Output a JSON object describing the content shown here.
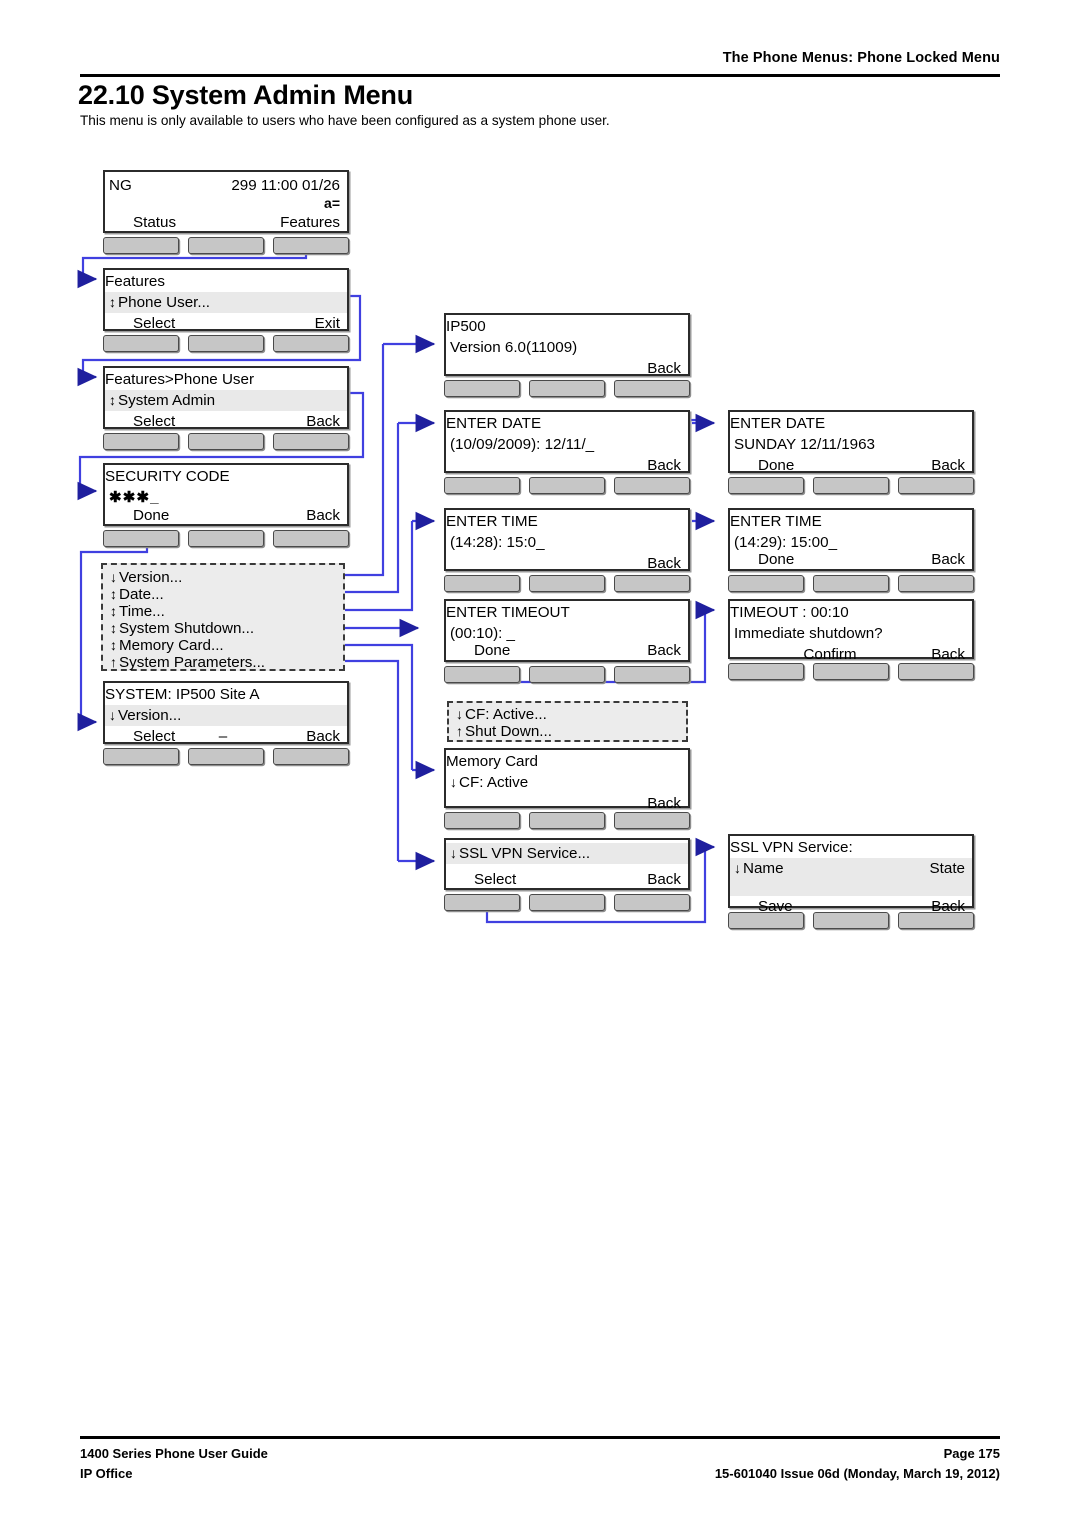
{
  "page": {
    "header": "The Phone Menus: Phone Locked Menu",
    "section_number": "22.10",
    "section_title": "System Admin Menu",
    "heading": "22.10 System Admin Menu",
    "intro": "This menu is only available to users who have been configured as a system phone user.",
    "footer": {
      "left_line1": "1400 Series Phone User Guide",
      "left_line2": "IP Office",
      "right_line1": "Page 175",
      "right_line2": "15-601040 Issue 06d (Monday, March 19, 2012)"
    }
  },
  "colors": {
    "wire": "#4040e0",
    "arrow": "#1f1f9e",
    "screen_border": "#2b2b2b",
    "highlight": "#e9e9e9",
    "key_fill": "#c6c6c6"
  },
  "screens": {
    "idle": {
      "name": "idle-screen",
      "line1_left": "NG",
      "line1_right": "299  11:00 01/26",
      "line2_right": "a=",
      "soft_left": "Status",
      "soft_right": "Features",
      "keys": 3
    },
    "features": {
      "name": "features-menu",
      "title": "Features",
      "item": "Phone User...",
      "item_indicator": "↕",
      "soft_left": "Select",
      "soft_right": "Exit",
      "keys": 3
    },
    "phone_user": {
      "name": "features-phone-user-menu",
      "title": "Features>Phone User",
      "item": "System Admin",
      "item_indicator": "↕",
      "soft_left": "Select",
      "soft_right": "Back",
      "keys": 3
    },
    "security_code": {
      "name": "security-code-entry",
      "title": "SECURITY CODE",
      "entry": "✱✱✱_",
      "soft_left": "Done",
      "soft_right": "Back",
      "keys": 3
    },
    "admin_list": {
      "name": "system-admin-option-list",
      "items": [
        {
          "indicator": "↓",
          "label": "Version..."
        },
        {
          "indicator": "↕",
          "label": "Date..."
        },
        {
          "indicator": "↕",
          "label": "Time..."
        },
        {
          "indicator": "↕",
          "label": "System Shutdown..."
        },
        {
          "indicator": "↕",
          "label": "Memory Card..."
        },
        {
          "indicator": "↑",
          "label": "System Parameters..."
        }
      ]
    },
    "system_site": {
      "name": "system-site-menu",
      "title": "SYSTEM: IP500 Site A",
      "item": "Version...",
      "item_indicator": "↓",
      "soft_left": "Select",
      "soft_mid": "–",
      "soft_right": "Back",
      "keys": 3
    },
    "version": {
      "name": "version-screen",
      "title": "IP500",
      "line2": "Version 6.0(11009)",
      "soft_right": "Back",
      "keys": 3
    },
    "enter_date": {
      "name": "enter-date-screen",
      "title": "ENTER DATE",
      "line2": "(10/09/2009): 12/11/_",
      "soft_right": "Back",
      "keys": 3
    },
    "enter_date_done": {
      "name": "enter-date-confirm-screen",
      "title": "ENTER DATE",
      "line2": "SUNDAY 12/11/1963",
      "soft_left": "Done",
      "soft_right": "Back",
      "keys": 3
    },
    "enter_time": {
      "name": "enter-time-screen",
      "title": "ENTER TIME",
      "line2": "(14:28): 15:0_",
      "soft_right": "Back",
      "keys": 3
    },
    "enter_time_done": {
      "name": "enter-time-confirm-screen",
      "title": "ENTER TIME",
      "line2": "(14:29): 15:00_",
      "soft_left": "Done",
      "soft_right": "Back",
      "keys": 3
    },
    "enter_timeout": {
      "name": "enter-timeout-screen",
      "title": "ENTER TIMEOUT",
      "line2": "(00:10): _",
      "soft_left": "Done",
      "soft_right": "Back",
      "keys": 3
    },
    "timeout_confirm": {
      "name": "timeout-confirm-screen",
      "title": "TIMEOUT : 00:10",
      "line2": "Immediate shutdown?",
      "soft_mid": "Confirm",
      "soft_right": "Back",
      "keys": 3
    },
    "memcard_list": {
      "name": "memory-card-option-list",
      "items": [
        {
          "indicator": "↓",
          "label": "CF: Active..."
        },
        {
          "indicator": "↑",
          "label": "Shut Down..."
        }
      ]
    },
    "memory_card": {
      "name": "memory-card-screen",
      "title": "Memory Card",
      "item": "CF: Active",
      "item_indicator": "↓",
      "soft_right": "Back",
      "keys": 3
    },
    "sslvpn_list": {
      "name": "ssl-vpn-option-screen",
      "item": "SSL VPN Service...",
      "item_indicator": "↓",
      "soft_left": "Select",
      "soft_right": "Back",
      "keys": 3
    },
    "sslvpn_detail": {
      "name": "ssl-vpn-service-detail-screen",
      "title": "SSL VPN Service:",
      "item_left": "Name",
      "item_indicator": "↓",
      "item_right": "State",
      "soft_left": "Save",
      "soft_right": "Back",
      "keys": 3
    }
  }
}
